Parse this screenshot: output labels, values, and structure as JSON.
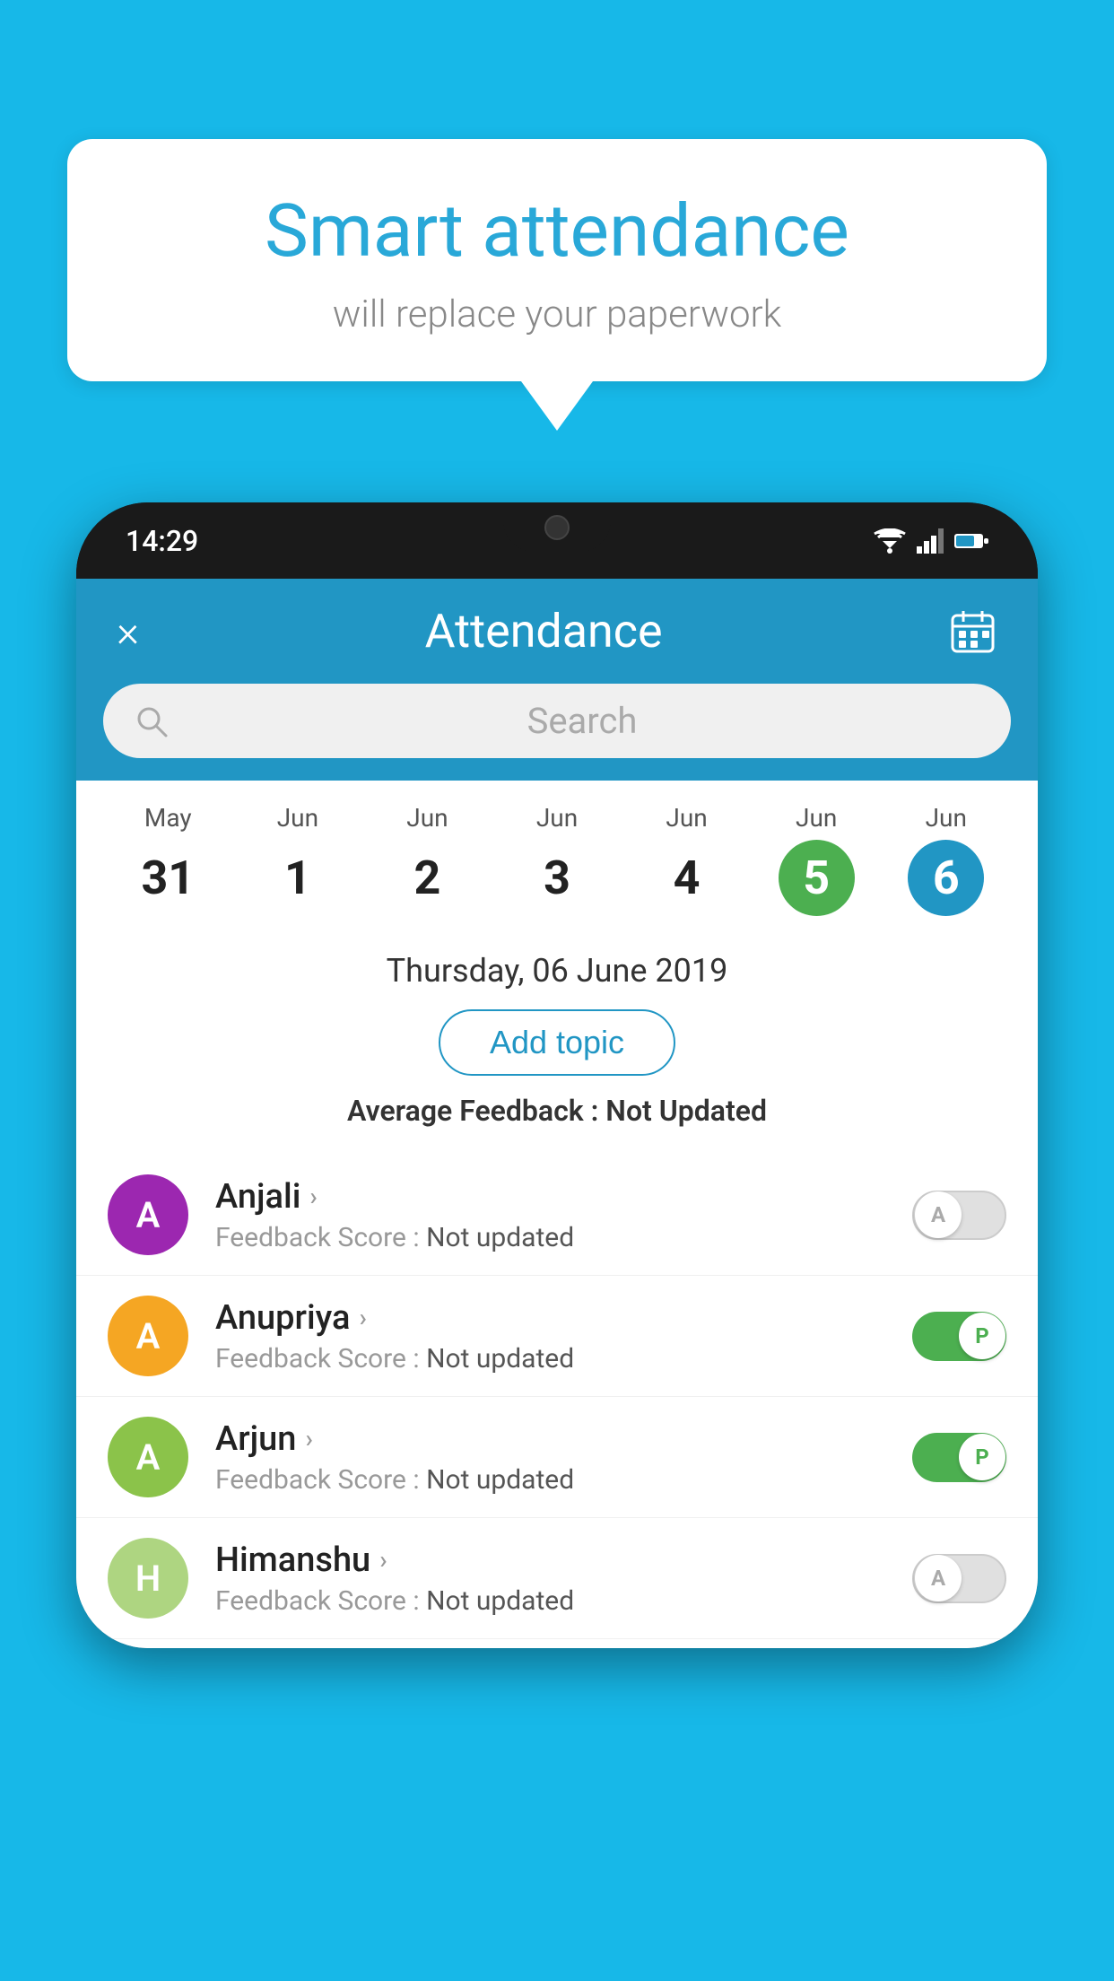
{
  "background_color": "#17b8e8",
  "speech_bubble": {
    "title": "Smart attendance",
    "subtitle": "will replace your paperwork"
  },
  "phone": {
    "status_bar": {
      "time": "14:29"
    },
    "header": {
      "title": "Attendance",
      "close_label": "×"
    },
    "search": {
      "placeholder": "Search"
    },
    "calendar": {
      "days": [
        {
          "month": "May",
          "date": "31",
          "style": "normal"
        },
        {
          "month": "Jun",
          "date": "1",
          "style": "normal"
        },
        {
          "month": "Jun",
          "date": "2",
          "style": "normal"
        },
        {
          "month": "Jun",
          "date": "3",
          "style": "normal"
        },
        {
          "month": "Jun",
          "date": "4",
          "style": "normal"
        },
        {
          "month": "Jun",
          "date": "5",
          "style": "green"
        },
        {
          "month": "Jun",
          "date": "6",
          "style": "blue"
        }
      ]
    },
    "selected_date": {
      "label": "Thursday, 06 June 2019",
      "add_topic_label": "Add topic",
      "average_feedback_label": "Average Feedback :",
      "average_feedback_value": "Not Updated"
    },
    "students": [
      {
        "name": "Anjali",
        "avatar_letter": "A",
        "avatar_color": "#9c27b0",
        "feedback_label": "Feedback Score :",
        "feedback_value": "Not updated",
        "toggle_state": "off",
        "toggle_letter": "A"
      },
      {
        "name": "Anupriya",
        "avatar_letter": "A",
        "avatar_color": "#f5a623",
        "feedback_label": "Feedback Score :",
        "feedback_value": "Not updated",
        "toggle_state": "on",
        "toggle_letter": "P"
      },
      {
        "name": "Arjun",
        "avatar_letter": "A",
        "avatar_color": "#8bc34a",
        "feedback_label": "Feedback Score :",
        "feedback_value": "Not updated",
        "toggle_state": "on",
        "toggle_letter": "P"
      },
      {
        "name": "Himanshu",
        "avatar_letter": "H",
        "avatar_color": "#aed581",
        "feedback_label": "Feedback Score :",
        "feedback_value": "Not updated",
        "toggle_state": "off",
        "toggle_letter": "A"
      }
    ]
  }
}
